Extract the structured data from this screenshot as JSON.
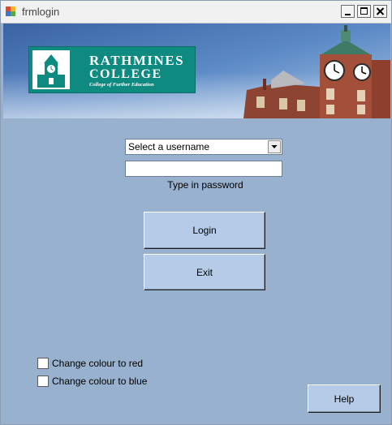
{
  "window": {
    "title": "frmlogin",
    "controls": {
      "minimize": "minimize-icon",
      "maximize": "maximize-icon",
      "close": "close-icon"
    }
  },
  "banner": {
    "logo": {
      "line1": "RATHMINES",
      "line2": "COLLEGE",
      "tagline": "College of Further Education"
    },
    "colors": {
      "logo_bg": "#0e8a80",
      "sky": "#3b66a6",
      "brick": "#a0503c"
    }
  },
  "form": {
    "username_select": {
      "selected": "Select a username"
    },
    "password": {
      "value": "",
      "label": "Type in password"
    },
    "login_label": "Login",
    "exit_label": "Exit",
    "help_label": "Help"
  },
  "options": {
    "red": {
      "label": "Change colour to red",
      "checked": false
    },
    "blue": {
      "label": "Change colour to blue",
      "checked": false
    }
  },
  "colors": {
    "form_bg": "#98b1cf",
    "button_bg": "#b5cbe7"
  }
}
